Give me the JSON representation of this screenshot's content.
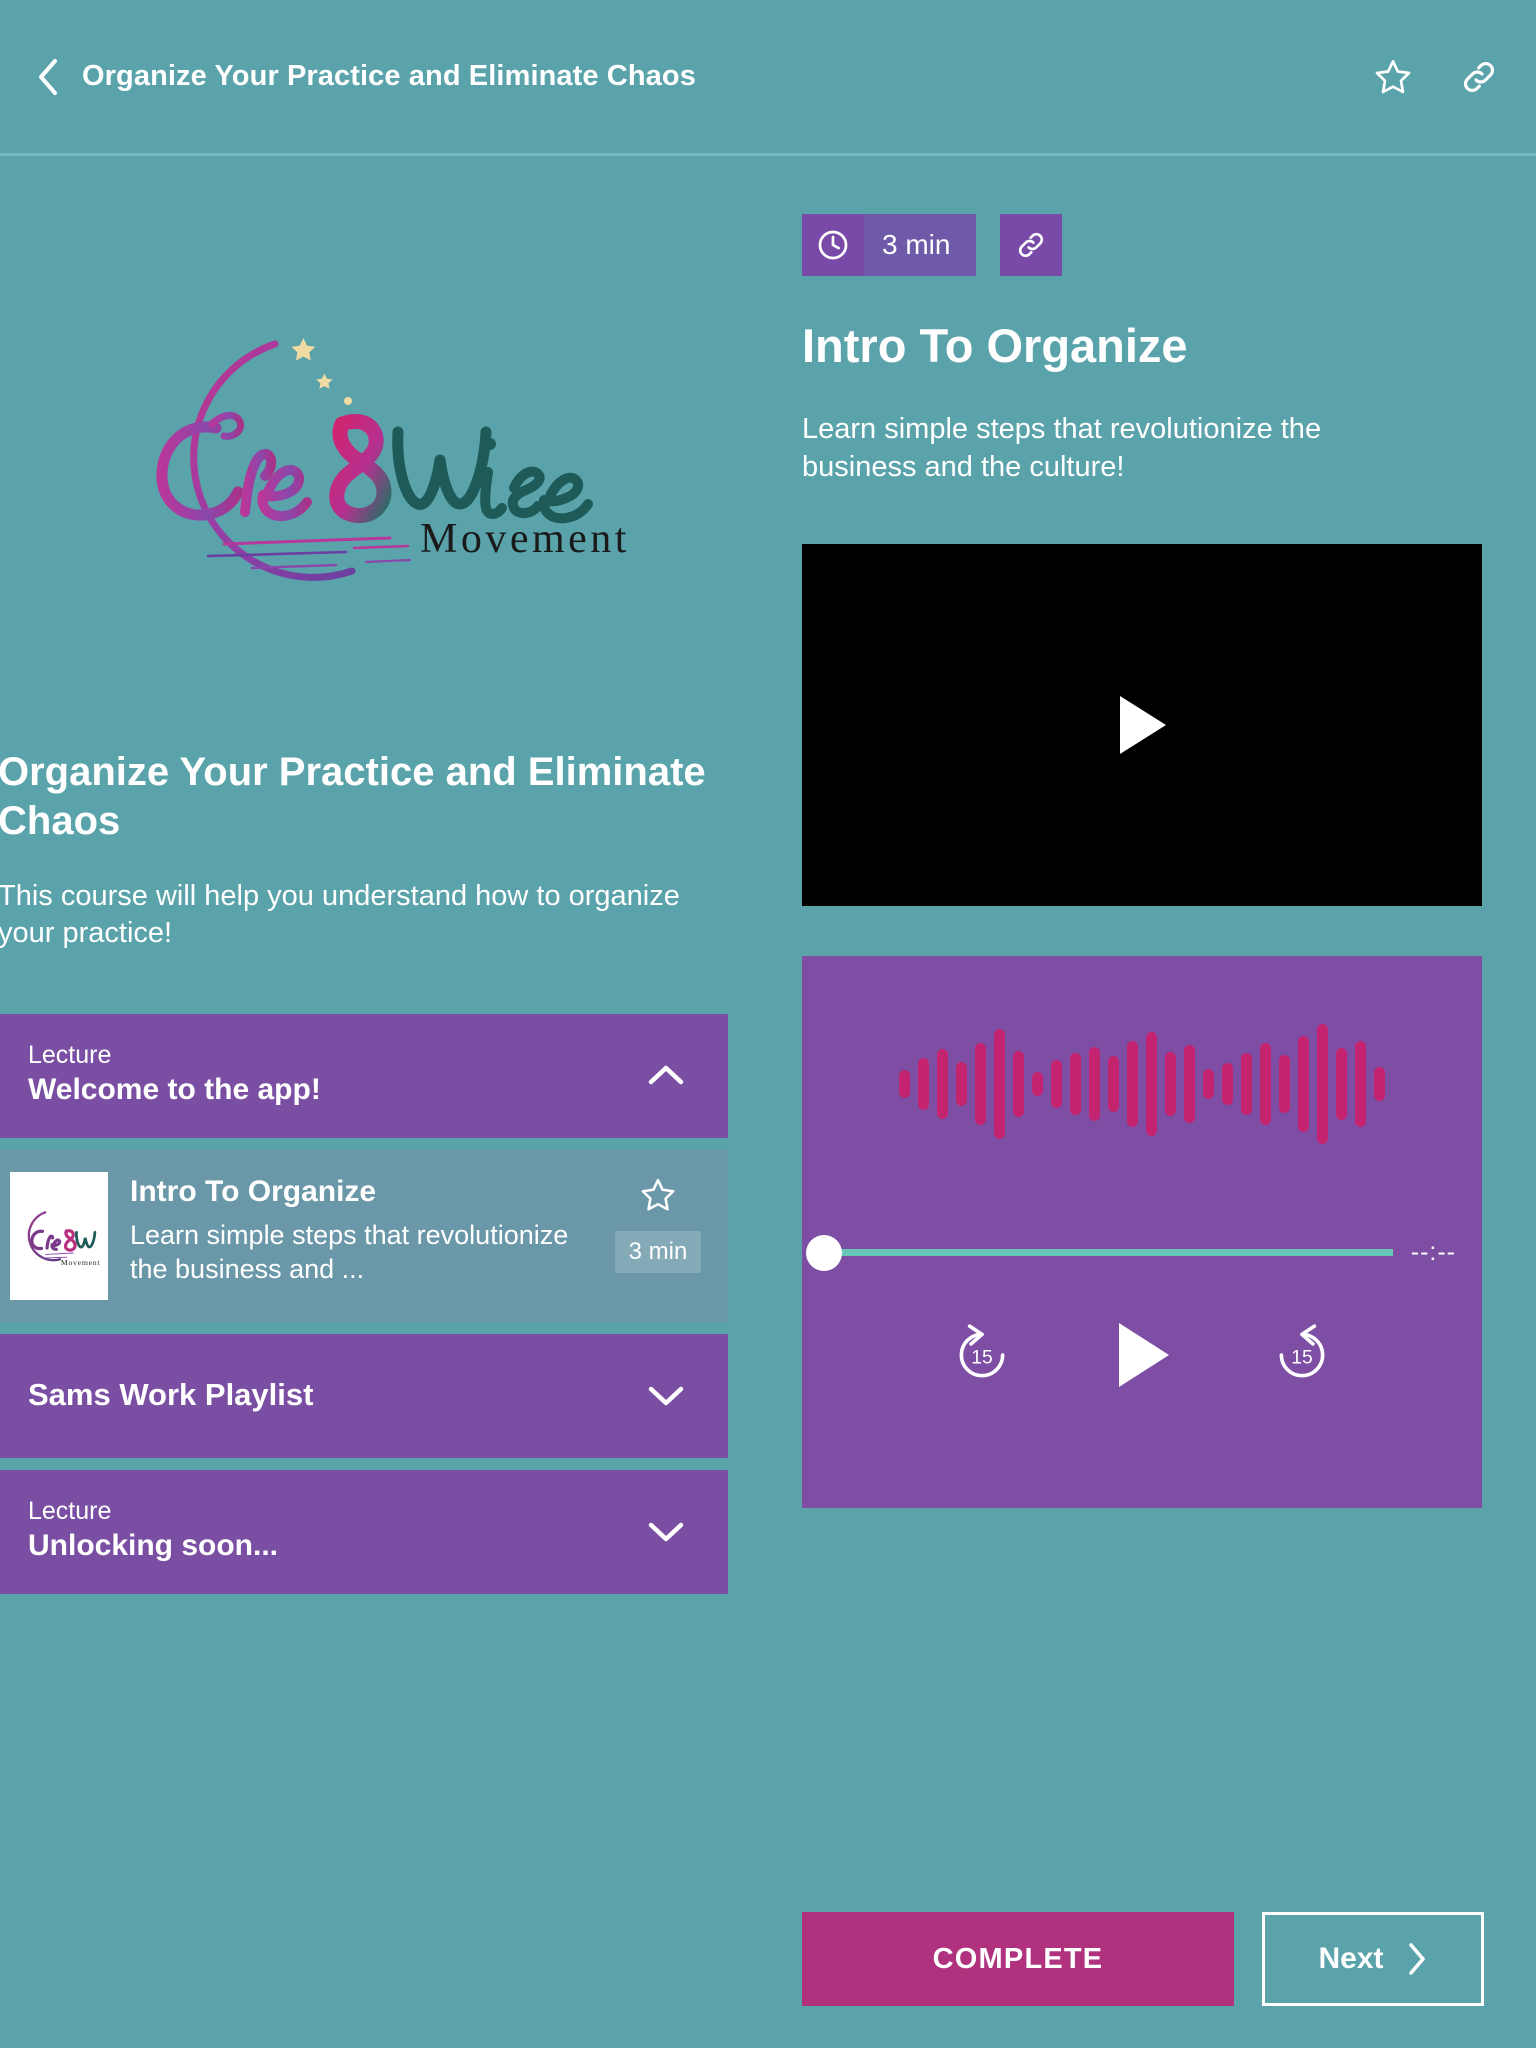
{
  "header": {
    "title": "Organize Your Practice and Eliminate Chaos",
    "back_icon": "chevron-left-icon",
    "favorite_icon": "star-outline-icon",
    "share_icon": "link-icon"
  },
  "colors": {
    "background_teal": "#5aa3ab",
    "accordion_purple": "#7a4fa3",
    "badge_purple": "#7a4aa8",
    "badge_purple_light": "#6e5aa8",
    "player_purple": "#7e4ea4",
    "waveform_pink": "#c4246f",
    "complete_magenta": "#b0327e",
    "seek_track_teal": "#69c6b8",
    "lesson_item_teal": "#6b98a8"
  },
  "sidebar": {
    "logo_alt": "Cre8Wise Movement",
    "course_title": "Organize Your Practice and Eliminate Chaos",
    "course_description": "This course will help you understand how to organize your practice!",
    "sections": [
      {
        "kicker": "Lecture",
        "label": "Welcome to the app!",
        "expanded": true,
        "chevron": "chevron-up-icon"
      },
      {
        "kicker": "",
        "label": "Sams Work Playlist",
        "expanded": false,
        "chevron": "chevron-down-icon"
      },
      {
        "kicker": "Lecture",
        "label": "Unlocking soon...",
        "expanded": false,
        "chevron": "chevron-down-icon"
      }
    ],
    "lesson_item": {
      "title": "Intro To Organize",
      "description": "Learn simple steps that revolutionize the business and ...",
      "duration": "3 min",
      "thumbnail_alt": "Cre8Wise Movement",
      "star_icon": "star-outline-icon"
    }
  },
  "main": {
    "duration_badge": {
      "clock_icon": "clock-icon",
      "duration": "3 min"
    },
    "share_badge_icon": "link-icon",
    "lesson_title": "Intro To Organize",
    "lesson_subtitle": "Learn simple steps that revolutionize the business and the culture!",
    "video": {
      "play_icon": "play-icon",
      "state": "paused"
    },
    "audio": {
      "waveform_heights": [
        28,
        52,
        70,
        44,
        82,
        110,
        66,
        24,
        48,
        62,
        74,
        56,
        86,
        104,
        64,
        78,
        30,
        42,
        62,
        82,
        58,
        96,
        120,
        72,
        86,
        34
      ],
      "progress_percent": 0,
      "time_display": "--:--",
      "rewind_label": "15",
      "forward_label": "15",
      "rewind_icon": "rewind-15-icon",
      "play_icon": "play-icon",
      "forward_icon": "forward-15-icon"
    }
  },
  "footer": {
    "complete_label": "COMPLETE",
    "next_label": "Next",
    "next_icon": "chevron-right-icon"
  }
}
